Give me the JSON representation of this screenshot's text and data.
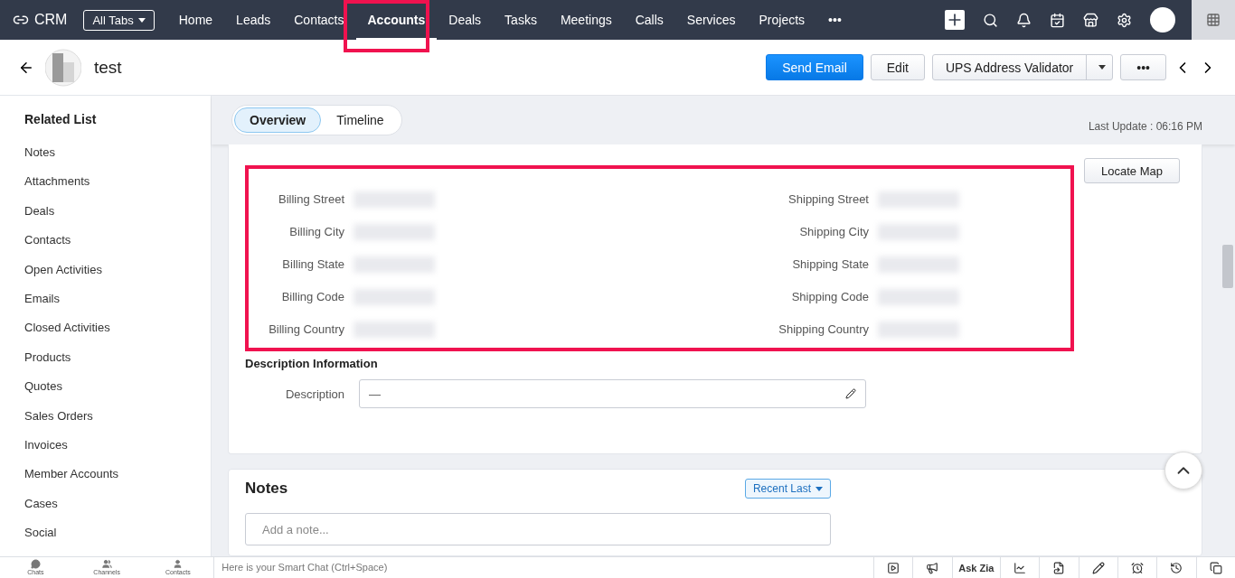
{
  "topnav": {
    "logo": "CRM",
    "all_tabs": "All Tabs",
    "tabs": [
      {
        "label": "Home",
        "selected": false
      },
      {
        "label": "Leads",
        "selected": false
      },
      {
        "label": "Contacts",
        "selected": false
      },
      {
        "label": "Accounts",
        "selected": true
      },
      {
        "label": "Deals",
        "selected": false
      },
      {
        "label": "Tasks",
        "selected": false
      },
      {
        "label": "Meetings",
        "selected": false
      },
      {
        "label": "Calls",
        "selected": false
      },
      {
        "label": "Services",
        "selected": false
      },
      {
        "label": "Projects",
        "selected": false
      }
    ],
    "more": "•••"
  },
  "header": {
    "title": "test",
    "buttons": {
      "send_email": "Send Email",
      "edit": "Edit",
      "validator": "UPS Address Validator",
      "more": "•••"
    }
  },
  "sidebar": {
    "title": "Related List",
    "items": [
      "Notes",
      "Attachments",
      "Deals",
      "Contacts",
      "Open Activities",
      "Emails",
      "Closed Activities",
      "Products",
      "Quotes",
      "Sales Orders",
      "Invoices",
      "Member Accounts",
      "Cases",
      "Social"
    ]
  },
  "view_tabs": [
    {
      "label": "Overview",
      "selected": true
    },
    {
      "label": "Timeline",
      "selected": false
    }
  ],
  "last_update": "Last Update : 06:16 PM",
  "address": {
    "locate_map": "Locate Map",
    "billing": [
      "Billing Street",
      "Billing City",
      "Billing State",
      "Billing Code",
      "Billing Country"
    ],
    "shipping": [
      "Shipping Street",
      "Shipping City",
      "Shipping State",
      "Shipping Code",
      "Shipping Country"
    ]
  },
  "description": {
    "heading": "Description Information",
    "label": "Description",
    "value": "—"
  },
  "notes": {
    "title": "Notes",
    "sort": "Recent Last",
    "placeholder": "Add a note..."
  },
  "bottom": {
    "items": [
      "Chats",
      "Channels",
      "Contacts"
    ],
    "smart_chat": "Here is your Smart Chat (Ctrl+Space)",
    "ask_zia": "Ask Zia"
  }
}
